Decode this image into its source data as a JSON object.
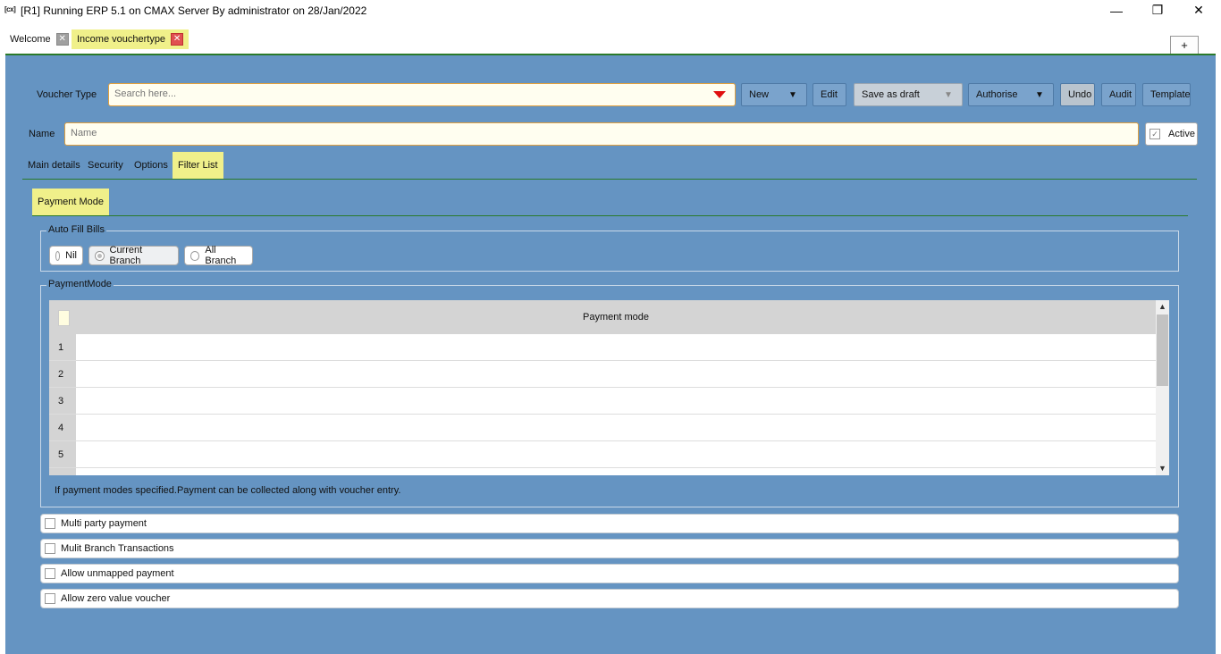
{
  "window": {
    "app_icon": "[cx]",
    "title": "[R1] Running ERP 5.1 on CMAX Server By administrator on 28/Jan/2022",
    "min_glyph": "—",
    "max_glyph": "❐",
    "close_glyph": "✕"
  },
  "tabs": [
    {
      "label": "Welcome"
    },
    {
      "label": "Income vouchertype"
    }
  ],
  "tab_close_glyph": "✕",
  "plus_label": "+",
  "toolbar": {
    "voucher_type_label": "Voucher Type",
    "search_placeholder": "Search here...",
    "new_label": "New",
    "edit_label": "Edit",
    "save_draft_label": "Save as draft",
    "authorise_label": "Authorise",
    "undo_label": "Undo",
    "audit_label": "Audit",
    "template_label": "Template",
    "caret": "▼"
  },
  "name_row": {
    "label": "Name",
    "placeholder": "Name",
    "active_label": "Active",
    "active_checked": true,
    "check_glyph": "✓"
  },
  "subtabs": [
    "Main details",
    "Security",
    "Options",
    "Filter List"
  ],
  "active_subtab": "Filter List",
  "payment_mode_tab": "Payment Mode",
  "auto_fill": {
    "legend": "Auto Fill Bills",
    "options": [
      "Nil",
      "Current Branch",
      "All Branch"
    ],
    "selected": "Current Branch"
  },
  "payment_mode": {
    "legend": "PaymentMode",
    "column_header": "Payment mode",
    "rows": [
      "1",
      "2",
      "3",
      "4",
      "5"
    ],
    "note": "If payment modes specified.Payment can be collected along with voucher entry.",
    "scroll_up": "▲",
    "scroll_down": "▼"
  },
  "options": [
    {
      "label": "Multi party payment",
      "checked": false
    },
    {
      "label": "Mulit Branch Transactions",
      "checked": false
    },
    {
      "label": "Allow unmapped payment",
      "checked": false
    },
    {
      "label": "Allow zero value voucher",
      "checked": false
    }
  ]
}
